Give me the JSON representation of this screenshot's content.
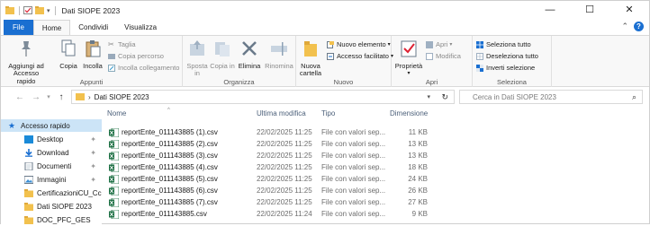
{
  "titlebar": {
    "title": "Dati SIOPE 2023",
    "minimize": "—",
    "maximize": "☐",
    "close": "✕"
  },
  "tabs": {
    "file": "File",
    "home": "Home",
    "share": "Condividi",
    "view": "Visualizza"
  },
  "ribbon": {
    "clipboard": {
      "pin_label": "Aggiungi ad Accesso rapido",
      "copy": "Copia",
      "paste": "Incolla",
      "cut": "Taglia",
      "copy_path": "Copia percorso",
      "paste_shortcut": "Incolla collegamento",
      "group": "Appunti"
    },
    "organize": {
      "move": "Sposta in",
      "copyto": "Copia in",
      "delete": "Elimina",
      "rename": "Rinomina",
      "group": "Organizza"
    },
    "new": {
      "new_folder": "Nuova cartella",
      "new_item": "Nuovo elemento",
      "easy_access": "Accesso facilitato",
      "group": "Nuovo"
    },
    "open": {
      "properties": "Proprietà",
      "open": "Apri",
      "edit": "Modifica",
      "group": "Apri"
    },
    "select": {
      "select_all": "Seleziona tutto",
      "select_none": "Deseleziona tutto",
      "invert": "Inverti selezione",
      "group": "Seleziona"
    }
  },
  "address": {
    "crumb": "Dati SIOPE 2023",
    "search_placeholder": "Cerca in Dati SIOPE 2023"
  },
  "navpane": {
    "items": [
      {
        "label": "Accesso rapido",
        "icon": "star-icon",
        "selected": true
      },
      {
        "label": "Desktop",
        "icon": "desktop-icon",
        "pinned": true
      },
      {
        "label": "Download",
        "icon": "download-icon",
        "pinned": true
      },
      {
        "label": "Documenti",
        "icon": "documents-icon",
        "pinned": true
      },
      {
        "label": "Immagini",
        "icon": "pictures-icon",
        "pinned": true
      },
      {
        "label": "CertificazioniCU_Cc",
        "icon": "folder-icon"
      },
      {
        "label": "Dati SIOPE 2023",
        "icon": "folder-icon"
      },
      {
        "label": "DOC_PFC_GES",
        "icon": "folder-icon"
      }
    ]
  },
  "filelist": {
    "columns": {
      "name": "Nome",
      "modified": "Ultima modifica",
      "type": "Tipo",
      "size": "Dimensione"
    },
    "rows": [
      {
        "name": "reportEnte_011143885 (1).csv",
        "modified": "22/02/2025 11:25",
        "type": "File con valori sep...",
        "size": "11 KB"
      },
      {
        "name": "reportEnte_011143885 (2).csv",
        "modified": "22/02/2025 11:25",
        "type": "File con valori sep...",
        "size": "13 KB"
      },
      {
        "name": "reportEnte_011143885 (3).csv",
        "modified": "22/02/2025 11:25",
        "type": "File con valori sep...",
        "size": "13 KB"
      },
      {
        "name": "reportEnte_011143885 (4).csv",
        "modified": "22/02/2025 11:25",
        "type": "File con valori sep...",
        "size": "18 KB"
      },
      {
        "name": "reportEnte_011143885 (5).csv",
        "modified": "22/02/2025 11:25",
        "type": "File con valori sep...",
        "size": "24 KB"
      },
      {
        "name": "reportEnte_011143885 (6).csv",
        "modified": "22/02/2025 11:25",
        "type": "File con valori sep...",
        "size": "26 KB"
      },
      {
        "name": "reportEnte_011143885 (7).csv",
        "modified": "22/02/2025 11:25",
        "type": "File con valori sep...",
        "size": "27 KB"
      },
      {
        "name": "reportEnte_011143885.csv",
        "modified": "22/02/2025 11:24",
        "type": "File con valori sep...",
        "size": "9 KB"
      }
    ]
  },
  "colors": {
    "accent": "#1a6fd1",
    "folder": "#f2c14e",
    "selection": "#cce4f7",
    "excel": "#1e7145"
  }
}
